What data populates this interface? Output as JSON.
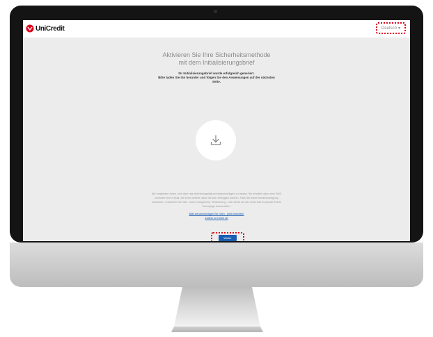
{
  "header": {
    "logo_text": "UniCredit",
    "language_label": "Deutsch"
  },
  "main": {
    "title_line1": "Aktivieren Sie Ihre Sicherheitsmethode",
    "title_line2": "mit dem Initialisierungsbrief",
    "subtitle_line1": "Ihr Initialisierungsbrief wurde erfolgreich generiert.",
    "subtitle_line2": "Bitte laden Sie ihn herunter und folgen Sie den Anweisungen auf der nächsten",
    "subtitle_line3": "Seite.",
    "info_line1": "Wir empfehlen Ihnen, sich über das Aktivierungsdatum benachrichtigen zu lassen. Sie erhalten dann eine SMS",
    "info_line2": "und/oder eine E-Mail, die Ihnen mitteilt, dass Sie sich einloggen können. Falls Sie keine Benachrichtigung",
    "info_line3": "wünschen, entziehen Sie bitte - nach erfolgreicher Verifizierung - sich direkt auf der UniCredit Corporate Portal",
    "info_line4": "Homepage anzumelden.",
    "link_line1": "Bitte benachrichtigen Sie mich - jetzt einrichten",
    "link_line2": "Zurück zu Home ab",
    "next_button": "Weiter"
  },
  "icons": {
    "logo": "unicredit-logo-icon",
    "language_chevron": "chevron-down-icon",
    "download": "download-icon"
  },
  "colors": {
    "brand_red": "#e2001a",
    "link_blue": "#1a5db4",
    "screen_background": "#ececec",
    "bezel": "#141414"
  }
}
